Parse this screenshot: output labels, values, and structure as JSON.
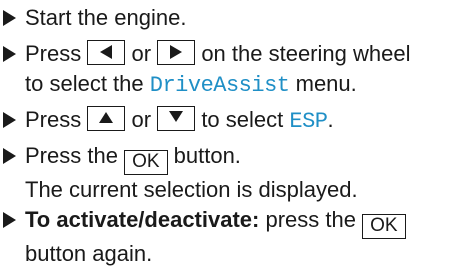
{
  "steps": [
    {
      "text": "Start the engine."
    },
    {
      "press": "Press",
      "or": "or",
      "rest": "on the steering wheel",
      "line2_pre": "to select the",
      "menu": "DriveAssist",
      "line2_post": "menu.",
      "key_left_icon": "triangle-left-icon",
      "key_right_icon": "triangle-right-icon"
    },
    {
      "press": "Press",
      "or": "or",
      "to_select": "to select",
      "item": "ESP",
      "end": ".",
      "key_up_icon": "triangle-up-icon",
      "key_down_icon": "triangle-down-icon"
    },
    {
      "press_the": "Press the",
      "key": "OK",
      "button": "button.",
      "line2": "The current selection is displayed."
    },
    {
      "bold": "To activate/deactivate:",
      "pre": "press the",
      "key": "OK",
      "line2": "button again."
    }
  ],
  "colors": {
    "accent": "#1f8fc6",
    "text": "#1a1a1a"
  }
}
